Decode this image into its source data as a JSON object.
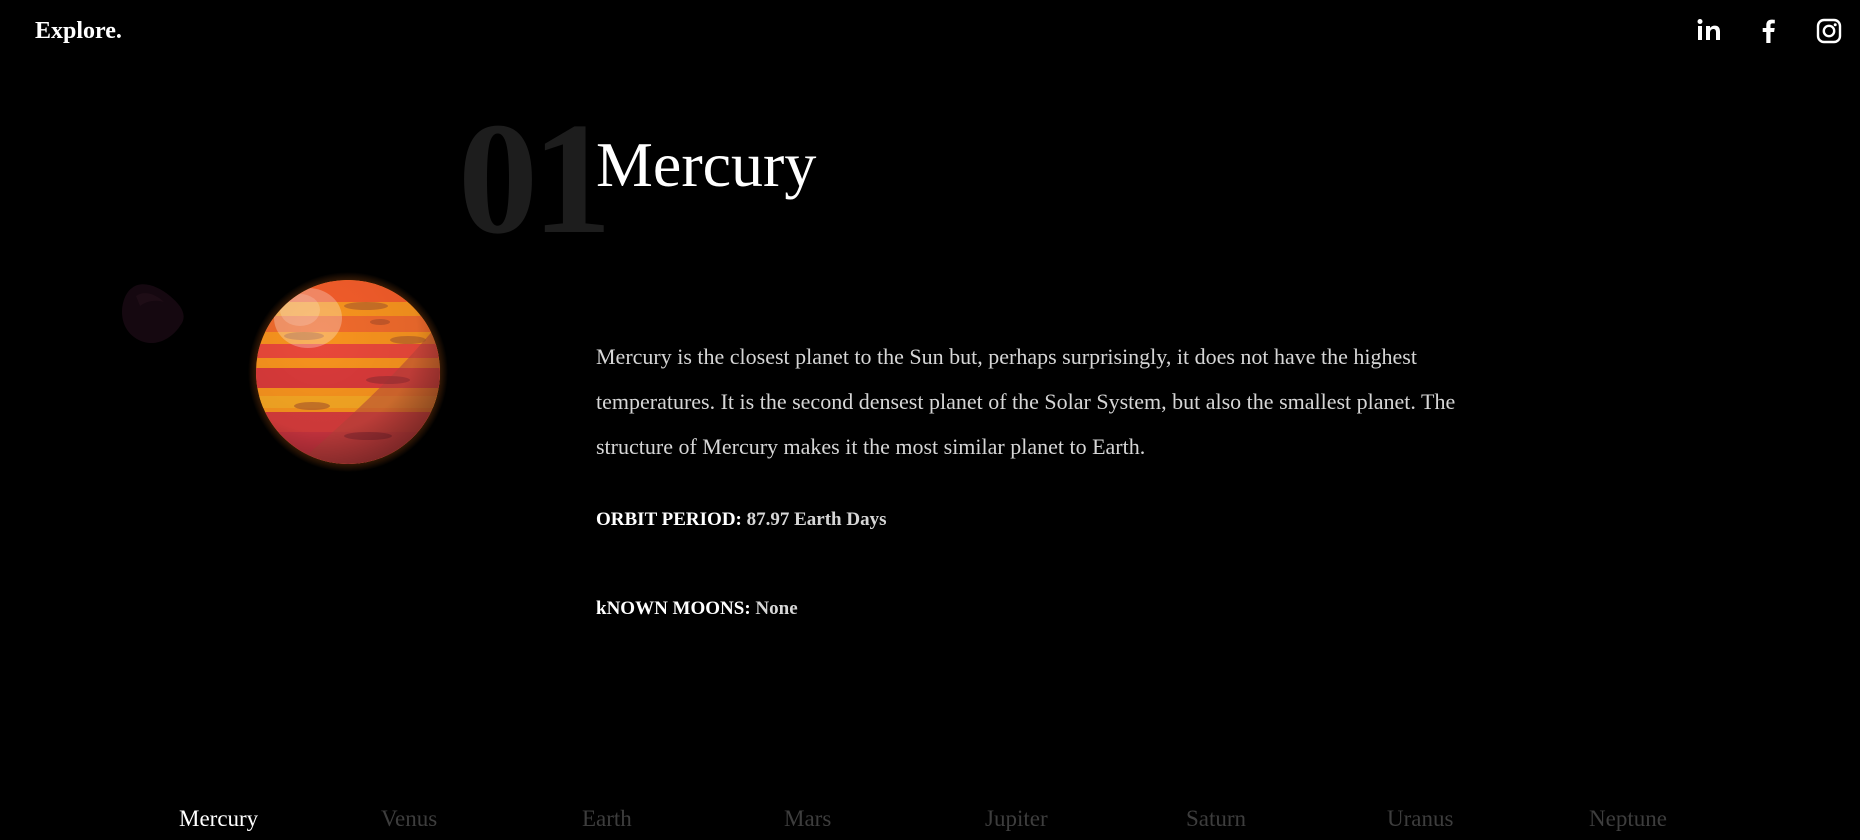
{
  "header": {
    "brand": "Explore.",
    "social": [
      {
        "icon": "linkedin-icon",
        "label": "in"
      },
      {
        "icon": "facebook-icon",
        "label": "f"
      },
      {
        "icon": "instagram-icon",
        "label": ""
      }
    ]
  },
  "planet": {
    "number": "01",
    "name": "Mercury",
    "description": "Mercury is the closest planet to the Sun but, perhaps surprisingly, it does not have the highest temperatures. It is the second densest planet of the Solar System, but also the smallest planet. The structure of Mercury makes it the most similar planet to Earth.",
    "orbit_label": "ORBIT PERIOD:",
    "orbit_value": "87.97 Earth Days",
    "moons_label": "kNOWN MOONS:",
    "moons_value": "None"
  },
  "nav": {
    "active": "Mercury",
    "items": [
      "Mercury",
      "Venus",
      "Earth",
      "Mars",
      "Jupiter",
      "Saturn",
      "Uranus",
      "Neptune"
    ]
  },
  "colors": {
    "background": "#000000",
    "planet_orange": "#f7931e",
    "planet_red": "#d93a3a",
    "inactive_nav": "#3d3d3d",
    "number_ghost": "#1d1d1d"
  }
}
